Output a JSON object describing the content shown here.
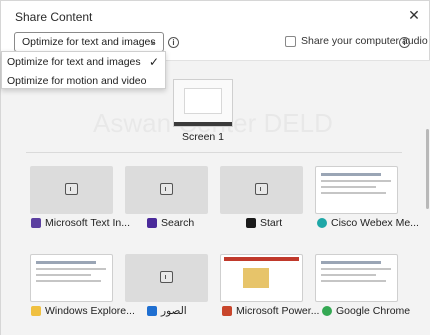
{
  "dialog": {
    "title": "Share Content",
    "close_glyph": "✕"
  },
  "controls": {
    "optimize_selected": "Optimize for text and images",
    "chevron_glyph": "⌄",
    "info_glyph": "i",
    "share_audio_label": "Share your computer audio",
    "share_audio_checked": false
  },
  "dropdown": {
    "options": [
      "Optimize for text and images",
      "Optimize for motion and video"
    ],
    "check_glyph": "✓"
  },
  "screens": [
    {
      "label": "Screen 1"
    }
  ],
  "watermark": "Aswan Center DELD",
  "apps": [
    {
      "label": "Microsoft Text In...",
      "icon": "text-input-icon",
      "color": "#5b3fa0"
    },
    {
      "label": "Search",
      "icon": "search-app-icon",
      "color": "#4a2a9a"
    },
    {
      "label": "Start",
      "icon": "start-icon",
      "color": "#1a1a1a"
    },
    {
      "label": "Cisco Webex Me...",
      "icon": "webex-icon",
      "color": "#1ea7a7"
    },
    {
      "label": "Windows Explore...",
      "icon": "explorer-icon",
      "color": "#f0c040"
    },
    {
      "label": "الصور",
      "icon": "photos-icon",
      "color": "#1f6fd1"
    },
    {
      "label": "Microsoft Power...",
      "icon": "powerpoint-icon",
      "color": "#c8452b"
    },
    {
      "label": "Google Chrome",
      "icon": "chrome-icon",
      "color": "#34a853"
    }
  ]
}
